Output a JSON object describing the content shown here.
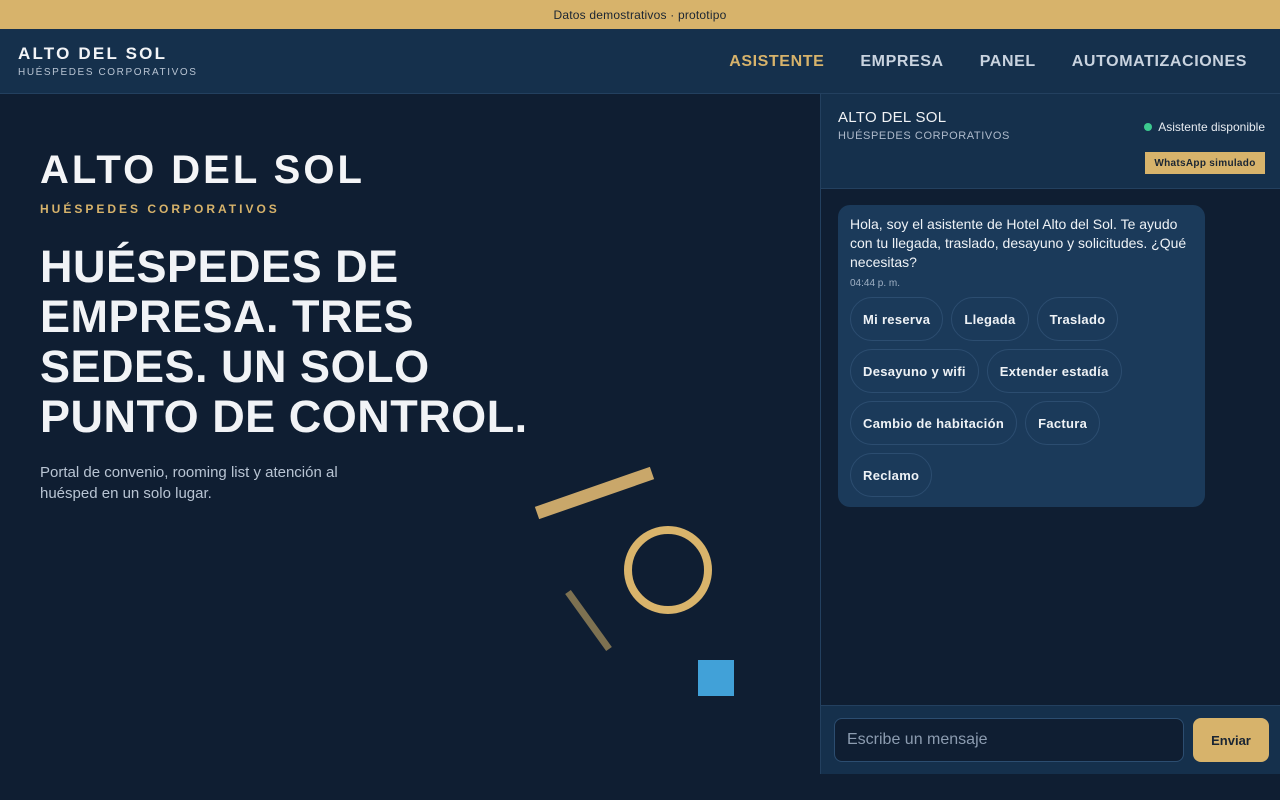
{
  "banner": {
    "text": "Datos demostrativos · prototipo"
  },
  "header": {
    "brand_name": "ALTO DEL SOL",
    "brand_sub": "HUÉSPEDES CORPORATIVOS",
    "nav": [
      {
        "label": "ASISTENTE",
        "active": true
      },
      {
        "label": "EMPRESA",
        "active": false
      },
      {
        "label": "PANEL",
        "active": false
      },
      {
        "label": "AUTOMATIZACIONES",
        "active": false
      }
    ]
  },
  "hero": {
    "brand_name": "ALTO DEL SOL",
    "brand_sub": "HUÉSPEDES CORPORATIVOS",
    "title": "HUÉSPEDES DE EMPRESA. TRES SEDES. UN SOLO PUNTO DE CONTROL.",
    "description": "Portal de convenio, rooming list y atención al huésped en un solo lugar."
  },
  "chat": {
    "title": "ALTO DEL SOL",
    "subtitle": "HUÉSPEDES CORPORATIVOS",
    "status": "Asistente disponible",
    "badge": "WhatsApp simulado",
    "message": {
      "text": "Hola, soy el asistente de Hotel Alto del Sol. Te ayudo con tu llegada, traslado, desayuno y solicitudes. ¿Qué necesitas?",
      "time": "04:44 p. m."
    },
    "quick_replies": [
      "Mi reserva",
      "Llegada",
      "Traslado",
      "Desayuno y wifi",
      "Extender estadía",
      "Cambio de habitación",
      "Factura",
      "Reclamo"
    ],
    "input": {
      "placeholder": "Escribe un mensaje",
      "value": ""
    },
    "send_label": "Enviar"
  },
  "colors": {
    "accent": "#d7b36b",
    "background": "#0f1e32",
    "panel": "#15304c",
    "status_online": "#3cc98f",
    "deco_blue": "#41a1d8"
  }
}
